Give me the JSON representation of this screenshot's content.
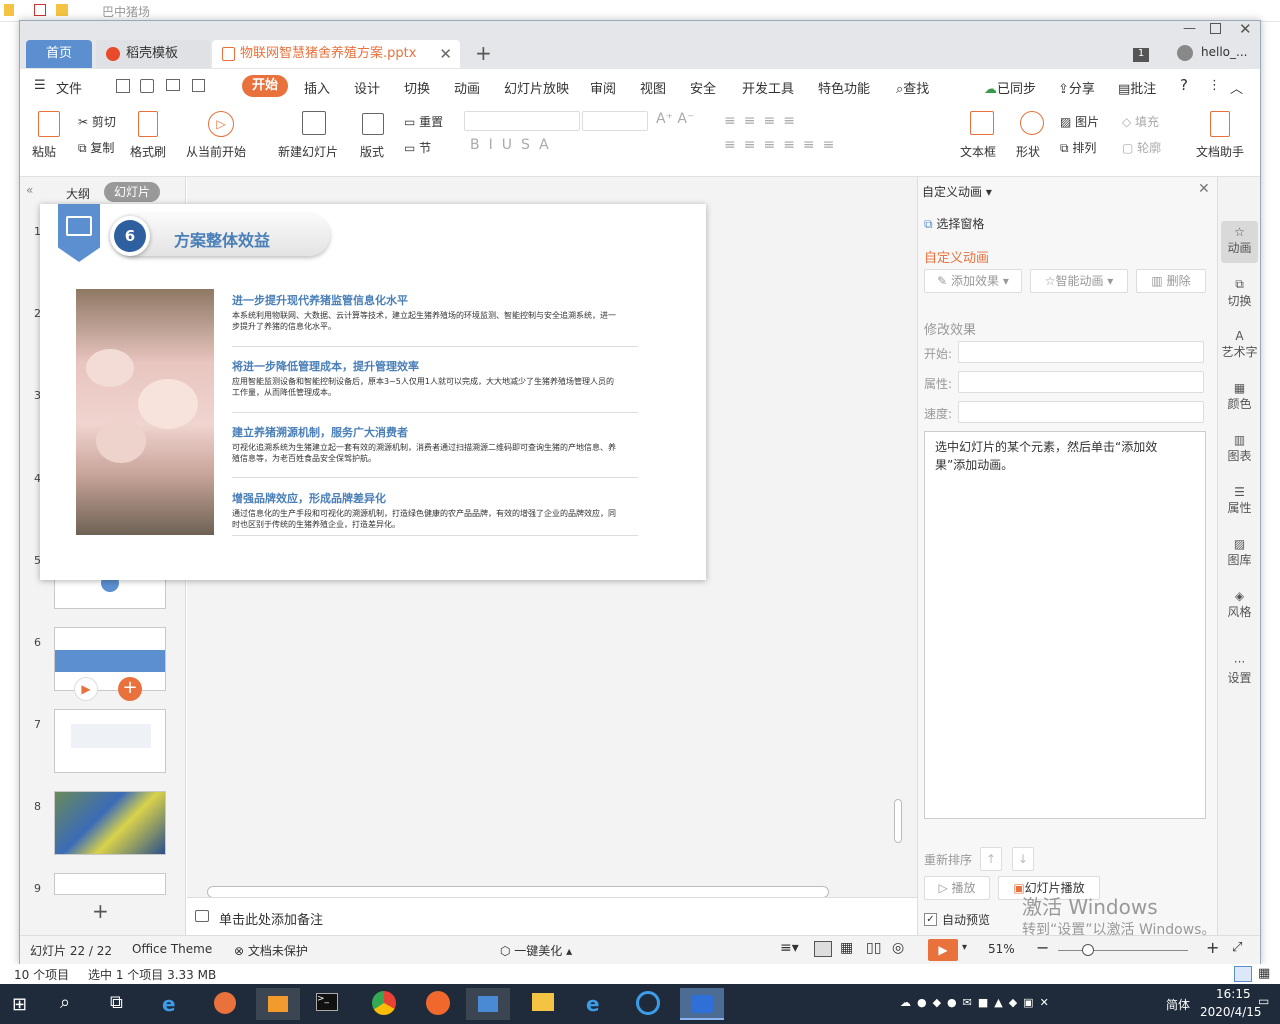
{
  "explorer": {
    "title": "巴中猪场",
    "status_items": "10 个项目",
    "status_selected": "选中 1 个项目  3.33 MB"
  },
  "tabs": {
    "home": "首页",
    "template": "稻壳模板",
    "doc": "物联网智慧猪舍养殖方案.pptx",
    "user": "hello_..."
  },
  "menu": {
    "file": "文件",
    "items": [
      "开始",
      "插入",
      "设计",
      "切换",
      "动画",
      "幻灯片放映",
      "审阅",
      "视图",
      "安全",
      "开发工具",
      "特色功能"
    ],
    "search": "查找",
    "sync": "已同步",
    "share": "分享",
    "comment": "批注",
    "help": "?"
  },
  "ribbon": {
    "paste": "粘贴",
    "cut": "剪切",
    "copy": "复制",
    "format_painter": "格式刷",
    "from_current": "从当前开始",
    "new_slide": "新建幻灯片",
    "layout": "版式",
    "reset": "重置",
    "section": "节",
    "textbox": "文本框",
    "shape": "形状",
    "picture": "图片",
    "arrange": "排列",
    "fill": "填充",
    "outline": "轮廓",
    "doc_assistant": "文档助手"
  },
  "thumbs": {
    "outline_tab": "大纲",
    "slides_tab": "幻灯片",
    "numbers": [
      "1",
      "2",
      "3",
      "4",
      "5",
      "6",
      "7",
      "8",
      "9"
    ]
  },
  "slide": {
    "badge_number": "6",
    "title": "方案整体效益",
    "items": [
      {
        "heading": "进一步提升现代养猪监管信息化水平",
        "body": "本系统利用物联网、大数据、云计算等技术，建立起生猪养殖场的环境监测、智能控制与安全追溯系统，进一步提升了养猪的信息化水平。"
      },
      {
        "heading": "将进一步降低管理成本，提升管理效率",
        "body": "应用智能监测设备和智能控制设备后，原本3~5人仅用1人就可以完成，大大地减少了生猪养殖场管理人员的工作量，从而降低管理成本。"
      },
      {
        "heading": "建立养猪溯源机制，服务广大消费者",
        "body": "可视化追溯系统为生猪建立起一套有效的溯源机制，消费者通过扫描溯源二维码即可查询生猪的产地信息、养殖信息等，为老百姓食品安全保驾护航。"
      },
      {
        "heading": "增强品牌效应，形成品牌差异化",
        "body": "通过信息化的生产手段和可视化的溯源机制，打造绿色健康的农产品品牌，有效的增强了企业的品牌效应，同时也区别于传统的生猪养殖企业，打造差异化。"
      }
    ]
  },
  "notes_placeholder": "单击此处添加备注",
  "anim_panel": {
    "header": "自定义动画",
    "select_pane": "选择窗格",
    "section": "自定义动画",
    "add_effect": "添加效果",
    "smart_anim": "智能动画",
    "delete": "删除",
    "modify": "修改效果",
    "start": "开始:",
    "property": "属性:",
    "speed": "速度:",
    "hint": "选中幻灯片的某个元素，然后单击“添加效果”添加动画。",
    "reorder": "重新排序",
    "play": "播放",
    "slideshow": "幻灯片播放",
    "auto_preview": "自动预览"
  },
  "side": [
    "动画",
    "切换",
    "艺术字",
    "颜色",
    "图表",
    "属性",
    "图库",
    "风格",
    "设置"
  ],
  "status": {
    "slide_count": "幻灯片 22 / 22",
    "theme": "Office Theme",
    "protect": "文档未保护",
    "beautify": "一键美化",
    "zoom": "51%"
  },
  "watermark": {
    "line1": "激活 Windows",
    "line2": "转到“设置”以激活 Windows。"
  },
  "tray": {
    "ime": "简体",
    "time": "16:15",
    "date": "2020/4/15"
  },
  "colors": {
    "accent": "#e8713c",
    "blue": "#4a7fb8",
    "header_blue": "#5b8fd0"
  }
}
